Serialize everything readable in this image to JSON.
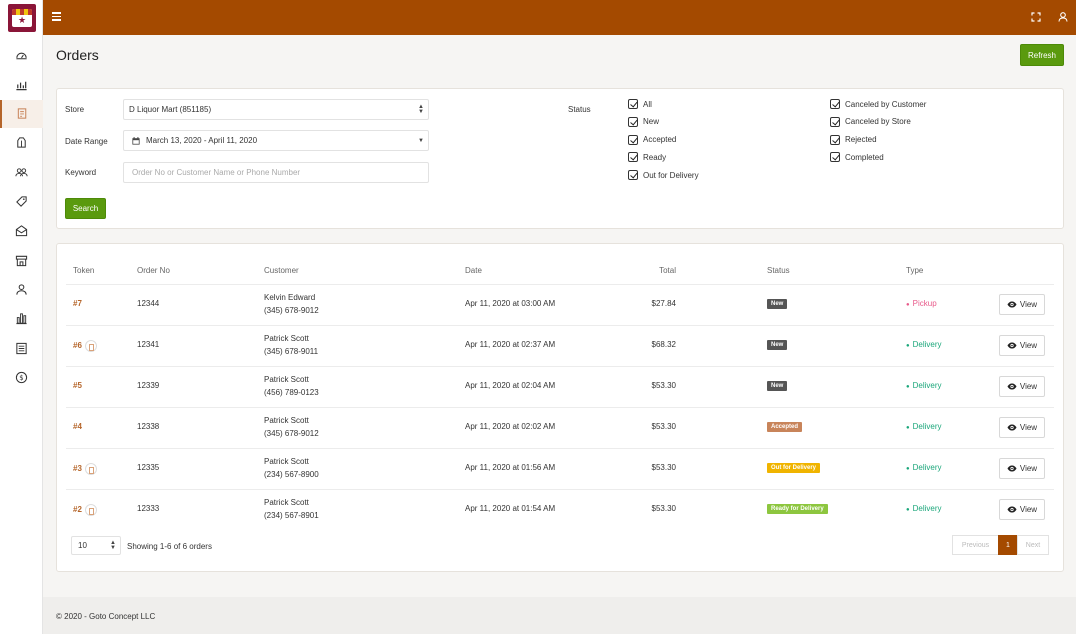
{
  "app": {
    "title": "Orders",
    "refresh_label": "Refresh",
    "footer": "© 2020 - Goto Concept LLC",
    "accent_color": "#a44a00",
    "button_color": "#5a9a0e"
  },
  "sidebar": {
    "items": [
      {
        "icon": "dashboard-icon"
      },
      {
        "icon": "chart-icon"
      },
      {
        "icon": "orders-icon",
        "active": true
      },
      {
        "icon": "products-icon"
      },
      {
        "icon": "customers-icon"
      },
      {
        "icon": "tag-icon"
      },
      {
        "icon": "mail-icon"
      },
      {
        "icon": "store-icon"
      },
      {
        "icon": "user-icon"
      },
      {
        "icon": "reports-icon"
      },
      {
        "icon": "list-icon"
      },
      {
        "icon": "dollar-icon"
      }
    ]
  },
  "filters": {
    "store_label": "Store",
    "store_value": "D Liquor Mart (851185)",
    "date_label": "Date Range",
    "date_value": "March 13, 2020 - April 11, 2020",
    "keyword_label": "Keyword",
    "keyword_placeholder": "Order No or Customer Name or Phone Number",
    "search_label": "Search",
    "status_label": "Status",
    "statuses": [
      "All",
      "New",
      "Accepted",
      "Ready",
      "Out for Delivery",
      "Canceled by Customer",
      "Canceled by Store",
      "Rejected",
      "Completed"
    ]
  },
  "table": {
    "headers": [
      "Token",
      "Order No",
      "Customer",
      "Date",
      "Total",
      "Status",
      "Type"
    ],
    "view_label": "View",
    "rows": [
      {
        "token": "#7",
        "note": false,
        "order": "12344",
        "name": "Kelvin Edward",
        "phone": "(345) 678-9012",
        "date": "Apr 11, 2020 at 03:00 AM",
        "total": "$27.84",
        "status": "New",
        "status_color": "#555555",
        "type": "Pickup",
        "type_color": "#e85a8a"
      },
      {
        "token": "#6",
        "note": true,
        "order": "12341",
        "name": "Patrick Scott",
        "phone": "(345) 678-9011",
        "date": "Apr 11, 2020 at 02:37 AM",
        "total": "$68.32",
        "status": "New",
        "status_color": "#555555",
        "type": "Delivery",
        "type_color": "#1aa67a"
      },
      {
        "token": "#5",
        "note": false,
        "order": "12339",
        "name": "Patrick Scott",
        "phone": "(456) 789-0123",
        "date": "Apr 11, 2020 at 02:04 AM",
        "total": "$53.30",
        "status": "New",
        "status_color": "#555555",
        "type": "Delivery",
        "type_color": "#1aa67a"
      },
      {
        "token": "#4",
        "note": false,
        "order": "12338",
        "name": "Patrick Scott",
        "phone": "(345) 678-9012",
        "date": "Apr 11, 2020 at 02:02 AM",
        "total": "$53.30",
        "status": "Accepted",
        "status_color": "#c8845a",
        "type": "Delivery",
        "type_color": "#1aa67a"
      },
      {
        "token": "#3",
        "note": true,
        "order": "12335",
        "name": "Patrick Scott",
        "phone": "(234) 567-8900",
        "date": "Apr 11, 2020 at 01:56 AM",
        "total": "$53.30",
        "status": "Out for Delivery",
        "status_color": "#f0b400",
        "type": "Delivery",
        "type_color": "#1aa67a"
      },
      {
        "token": "#2",
        "note": true,
        "order": "12333",
        "name": "Patrick Scott",
        "phone": "(234) 567-8901",
        "date": "Apr 11, 2020 at 01:54 AM",
        "total": "$53.30",
        "status": "Ready for Delivery",
        "status_color": "#8dc63f",
        "type": "Delivery",
        "type_color": "#1aa67a"
      }
    ]
  },
  "pagination": {
    "page_size": "10",
    "summary": "Showing 1-6 of 6 orders",
    "previous": "Previous",
    "current": "1",
    "next": "Next"
  }
}
